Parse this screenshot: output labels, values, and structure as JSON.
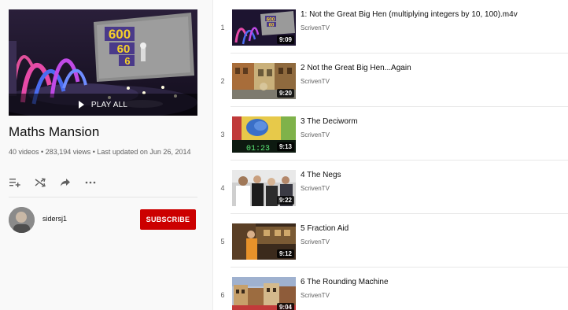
{
  "playlist": {
    "title": "Maths Mansion",
    "meta_line": "40 videos • 283,194 views • Last updated on Jun 26, 2014",
    "play_all_label": "PLAY ALL",
    "hero_numbers": [
      "600",
      "60",
      "6"
    ],
    "actions": [
      {
        "name": "add-to-queue-icon",
        "glyph": "add-to-queue"
      },
      {
        "name": "shuffle-icon",
        "glyph": "shuffle"
      },
      {
        "name": "share-icon",
        "glyph": "share"
      },
      {
        "name": "more-icon",
        "glyph": "more"
      }
    ]
  },
  "owner": {
    "name": "sidersj1",
    "subscribe_label": "SUBSCRIBE"
  },
  "colors": {
    "subscribe_red": "#cc0000",
    "meta_gray": "#606060"
  },
  "videos": [
    {
      "index": "1",
      "title": "1: Not the Great Big Hen (multiplying integers by 10, 100).m4v",
      "channel": "ScrivenTV",
      "duration": "9:09",
      "thumb_numbers": [
        "600",
        "60",
        "6"
      ]
    },
    {
      "index": "2",
      "title": "2 Not the Great Big Hen...Again",
      "channel": "ScrivenTV",
      "duration": "9:20"
    },
    {
      "index": "3",
      "title": "3 The Deciworm",
      "channel": "ScrivenTV",
      "duration": "9:13",
      "thumb_readout": "01:23"
    },
    {
      "index": "4",
      "title": "4 The Negs",
      "channel": "ScrivenTV",
      "duration": "9:22"
    },
    {
      "index": "5",
      "title": "5 Fraction Aid",
      "channel": "ScrivenTV",
      "duration": "9:12"
    },
    {
      "index": "6",
      "title": "6 The Rounding Machine",
      "channel": "ScrivenTV",
      "duration": "9:04"
    }
  ]
}
